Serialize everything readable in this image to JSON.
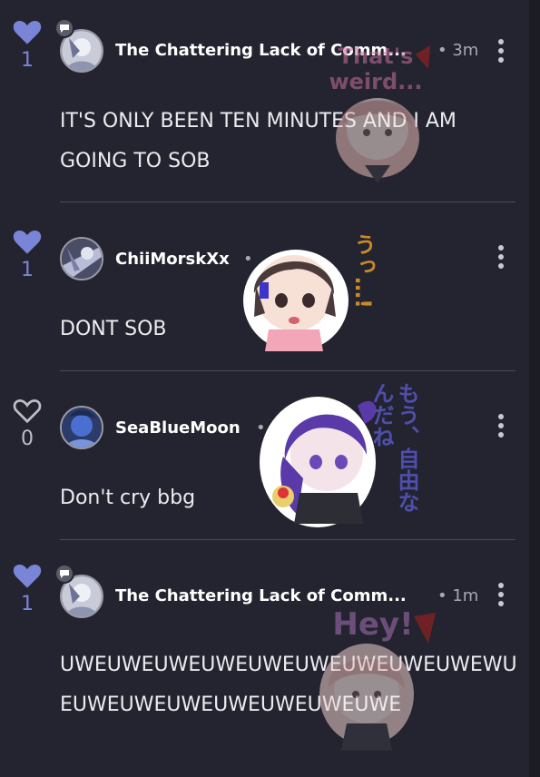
{
  "comments": [
    {
      "liked": true,
      "like_count": "1",
      "username": "The Chattering Lack of Comm...",
      "time": "• 3m",
      "text_lines": [
        "IT'S ONLY BEEN TEN MINUTES AND I AM",
        "GOING TO SOB"
      ],
      "sticker_text": "That's weird..."
    },
    {
      "liked": true,
      "like_count": "1",
      "username": "ChiiMorskXx",
      "time": "•",
      "text_lines": [
        "DONT SOB"
      ],
      "sticker_text": "うっ…!"
    },
    {
      "liked": false,
      "like_count": "0",
      "username": "SeaBlueMoon",
      "time": "•",
      "text_lines": [
        "Don't cry bbg"
      ],
      "sticker_text": "もう、自由なんだね"
    },
    {
      "liked": true,
      "like_count": "1",
      "username": "The Chattering Lack of Comm...",
      "time": "• 1m",
      "text_lines": [
        "UWEUWEUWEUWEUWEUWEUWEUWEUWEWU",
        "EUWEUWEUWEUWEUWEUWEUWE"
      ],
      "sticker_text": "Hey!"
    }
  ],
  "colors": {
    "background": "#23242f",
    "like_accent": "#7b85d8",
    "divider": "#4a4b58"
  },
  "icons": {
    "like": "heart-icon",
    "more": "kebab-menu-icon",
    "badge": "chat-bubble-icon"
  }
}
